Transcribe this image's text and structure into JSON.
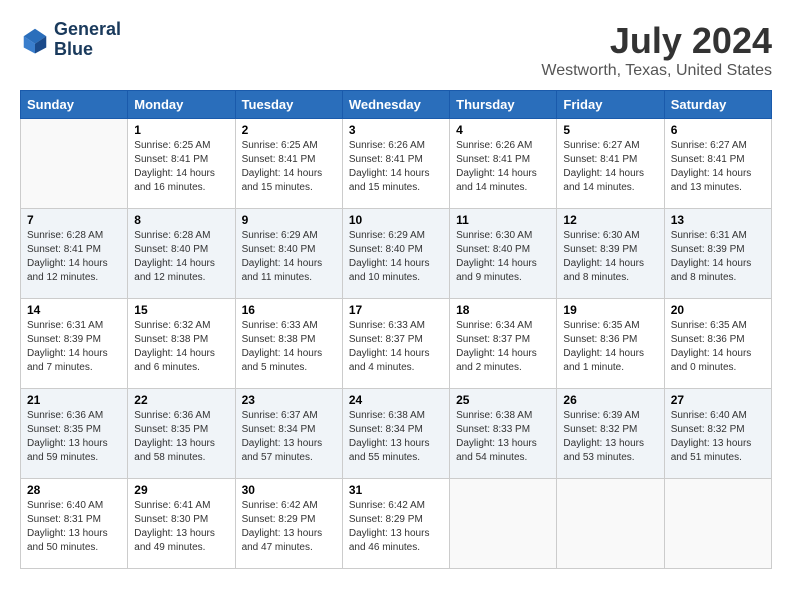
{
  "logo": {
    "line1": "General",
    "line2": "Blue"
  },
  "title": "July 2024",
  "location": "Westworth, Texas, United States",
  "weekdays": [
    "Sunday",
    "Monday",
    "Tuesday",
    "Wednesday",
    "Thursday",
    "Friday",
    "Saturday"
  ],
  "weeks": [
    [
      {
        "day": "",
        "info": ""
      },
      {
        "day": "1",
        "info": "Sunrise: 6:25 AM\nSunset: 8:41 PM\nDaylight: 14 hours\nand 16 minutes."
      },
      {
        "day": "2",
        "info": "Sunrise: 6:25 AM\nSunset: 8:41 PM\nDaylight: 14 hours\nand 15 minutes."
      },
      {
        "day": "3",
        "info": "Sunrise: 6:26 AM\nSunset: 8:41 PM\nDaylight: 14 hours\nand 15 minutes."
      },
      {
        "day": "4",
        "info": "Sunrise: 6:26 AM\nSunset: 8:41 PM\nDaylight: 14 hours\nand 14 minutes."
      },
      {
        "day": "5",
        "info": "Sunrise: 6:27 AM\nSunset: 8:41 PM\nDaylight: 14 hours\nand 14 minutes."
      },
      {
        "day": "6",
        "info": "Sunrise: 6:27 AM\nSunset: 8:41 PM\nDaylight: 14 hours\nand 13 minutes."
      }
    ],
    [
      {
        "day": "7",
        "info": "Sunrise: 6:28 AM\nSunset: 8:41 PM\nDaylight: 14 hours\nand 12 minutes."
      },
      {
        "day": "8",
        "info": "Sunrise: 6:28 AM\nSunset: 8:40 PM\nDaylight: 14 hours\nand 12 minutes."
      },
      {
        "day": "9",
        "info": "Sunrise: 6:29 AM\nSunset: 8:40 PM\nDaylight: 14 hours\nand 11 minutes."
      },
      {
        "day": "10",
        "info": "Sunrise: 6:29 AM\nSunset: 8:40 PM\nDaylight: 14 hours\nand 10 minutes."
      },
      {
        "day": "11",
        "info": "Sunrise: 6:30 AM\nSunset: 8:40 PM\nDaylight: 14 hours\nand 9 minutes."
      },
      {
        "day": "12",
        "info": "Sunrise: 6:30 AM\nSunset: 8:39 PM\nDaylight: 14 hours\nand 8 minutes."
      },
      {
        "day": "13",
        "info": "Sunrise: 6:31 AM\nSunset: 8:39 PM\nDaylight: 14 hours\nand 8 minutes."
      }
    ],
    [
      {
        "day": "14",
        "info": "Sunrise: 6:31 AM\nSunset: 8:39 PM\nDaylight: 14 hours\nand 7 minutes."
      },
      {
        "day": "15",
        "info": "Sunrise: 6:32 AM\nSunset: 8:38 PM\nDaylight: 14 hours\nand 6 minutes."
      },
      {
        "day": "16",
        "info": "Sunrise: 6:33 AM\nSunset: 8:38 PM\nDaylight: 14 hours\nand 5 minutes."
      },
      {
        "day": "17",
        "info": "Sunrise: 6:33 AM\nSunset: 8:37 PM\nDaylight: 14 hours\nand 4 minutes."
      },
      {
        "day": "18",
        "info": "Sunrise: 6:34 AM\nSunset: 8:37 PM\nDaylight: 14 hours\nand 2 minutes."
      },
      {
        "day": "19",
        "info": "Sunrise: 6:35 AM\nSunset: 8:36 PM\nDaylight: 14 hours\nand 1 minute."
      },
      {
        "day": "20",
        "info": "Sunrise: 6:35 AM\nSunset: 8:36 PM\nDaylight: 14 hours\nand 0 minutes."
      }
    ],
    [
      {
        "day": "21",
        "info": "Sunrise: 6:36 AM\nSunset: 8:35 PM\nDaylight: 13 hours\nand 59 minutes."
      },
      {
        "day": "22",
        "info": "Sunrise: 6:36 AM\nSunset: 8:35 PM\nDaylight: 13 hours\nand 58 minutes."
      },
      {
        "day": "23",
        "info": "Sunrise: 6:37 AM\nSunset: 8:34 PM\nDaylight: 13 hours\nand 57 minutes."
      },
      {
        "day": "24",
        "info": "Sunrise: 6:38 AM\nSunset: 8:34 PM\nDaylight: 13 hours\nand 55 minutes."
      },
      {
        "day": "25",
        "info": "Sunrise: 6:38 AM\nSunset: 8:33 PM\nDaylight: 13 hours\nand 54 minutes."
      },
      {
        "day": "26",
        "info": "Sunrise: 6:39 AM\nSunset: 8:32 PM\nDaylight: 13 hours\nand 53 minutes."
      },
      {
        "day": "27",
        "info": "Sunrise: 6:40 AM\nSunset: 8:32 PM\nDaylight: 13 hours\nand 51 minutes."
      }
    ],
    [
      {
        "day": "28",
        "info": "Sunrise: 6:40 AM\nSunset: 8:31 PM\nDaylight: 13 hours\nand 50 minutes."
      },
      {
        "day": "29",
        "info": "Sunrise: 6:41 AM\nSunset: 8:30 PM\nDaylight: 13 hours\nand 49 minutes."
      },
      {
        "day": "30",
        "info": "Sunrise: 6:42 AM\nSunset: 8:29 PM\nDaylight: 13 hours\nand 47 minutes."
      },
      {
        "day": "31",
        "info": "Sunrise: 6:42 AM\nSunset: 8:29 PM\nDaylight: 13 hours\nand 46 minutes."
      },
      {
        "day": "",
        "info": ""
      },
      {
        "day": "",
        "info": ""
      },
      {
        "day": "",
        "info": ""
      }
    ]
  ]
}
